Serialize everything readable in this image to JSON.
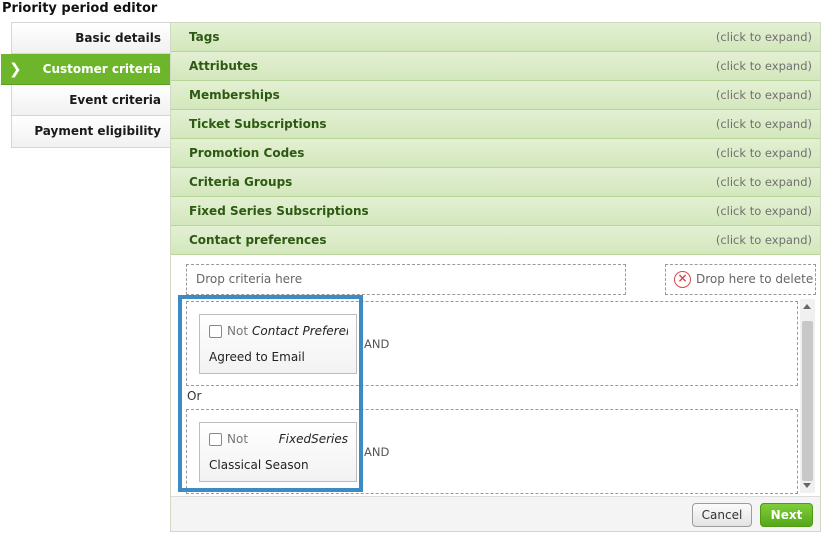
{
  "page": {
    "title": "Priority period editor"
  },
  "nav": {
    "items": [
      {
        "label": "Basic details"
      },
      {
        "label": "Customer criteria",
        "active": true
      },
      {
        "label": "Event criteria"
      },
      {
        "label": "Payment eligibility"
      }
    ],
    "chevron": "❯"
  },
  "accordion": {
    "hint": "(click to expand)",
    "sections": [
      {
        "label": "Tags"
      },
      {
        "label": "Attributes"
      },
      {
        "label": "Memberships"
      },
      {
        "label": "Ticket Subscriptions"
      },
      {
        "label": "Promotion Codes"
      },
      {
        "label": "Criteria Groups"
      },
      {
        "label": "Fixed Series Subscriptions"
      },
      {
        "label": "Contact preferences"
      }
    ]
  },
  "drop_zones": {
    "criteria": "Drop criteria here",
    "delete": "Drop here to delete",
    "delete_icon": "×"
  },
  "groups": [
    {
      "criterion": {
        "not_label": "Not",
        "type": "Contact Preferences",
        "value": "Agreed to Email",
        "not_checked": false
      },
      "joiner": "AND"
    },
    {
      "criterion": {
        "not_label": "Not",
        "type": "FixedSeries",
        "value": "Classical Season",
        "not_checked": false
      },
      "joiner": "AND"
    }
  ],
  "or_label": "Or",
  "buttons": {
    "cancel": "Cancel",
    "next": "Next"
  },
  "colors": {
    "accent_green": "#6db62b",
    "highlight_blue": "#3d8bc4",
    "delete_red": "#d34b4b"
  }
}
